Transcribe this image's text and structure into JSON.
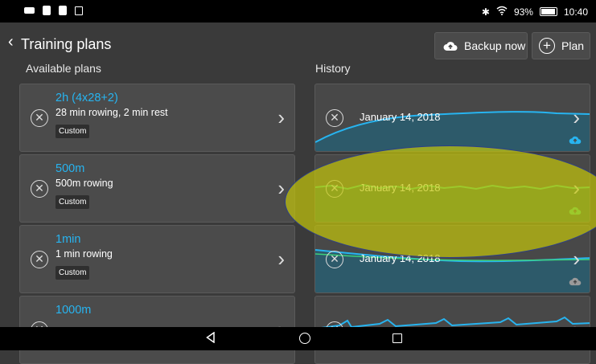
{
  "status_bar": {
    "battery": "93%",
    "time": "10:40",
    "icons": [
      "camera-icon",
      "notification-icon",
      "notification-icon",
      "image-icon",
      "bluetooth-icon",
      "wifi-icon",
      "battery-icon"
    ]
  },
  "app_bar": {
    "title": "Training plans",
    "backup_label": "Backup now",
    "plan_label": "Plan"
  },
  "sections": {
    "plans": "Available plans",
    "history": "History"
  },
  "plans": [
    {
      "name": "2h (4x28+2)",
      "description": "28 min rowing, 2 min rest",
      "badge": "Custom"
    },
    {
      "name": "500m",
      "description": "500m rowing",
      "badge": "Custom"
    },
    {
      "name": "1min",
      "description": "1 min rowing",
      "badge": "Custom"
    },
    {
      "name": "1000m",
      "description": "",
      "badge": ""
    }
  ],
  "history": [
    {
      "date": "January 14, 2018",
      "cloud_color": "#27b4f0"
    },
    {
      "date": "January 14, 2018",
      "cloud_color": "#3ecf7a"
    },
    {
      "date": "January 14, 2018",
      "cloud_color": "#9a9a9a"
    },
    {
      "date": "",
      "cloud_color": "#27b4f0"
    }
  ],
  "colors": {
    "accent": "#27b4f0",
    "highlight": "#c4c60a"
  },
  "nav": {
    "icons": [
      "back-icon",
      "home-icon",
      "recents-icon"
    ]
  }
}
